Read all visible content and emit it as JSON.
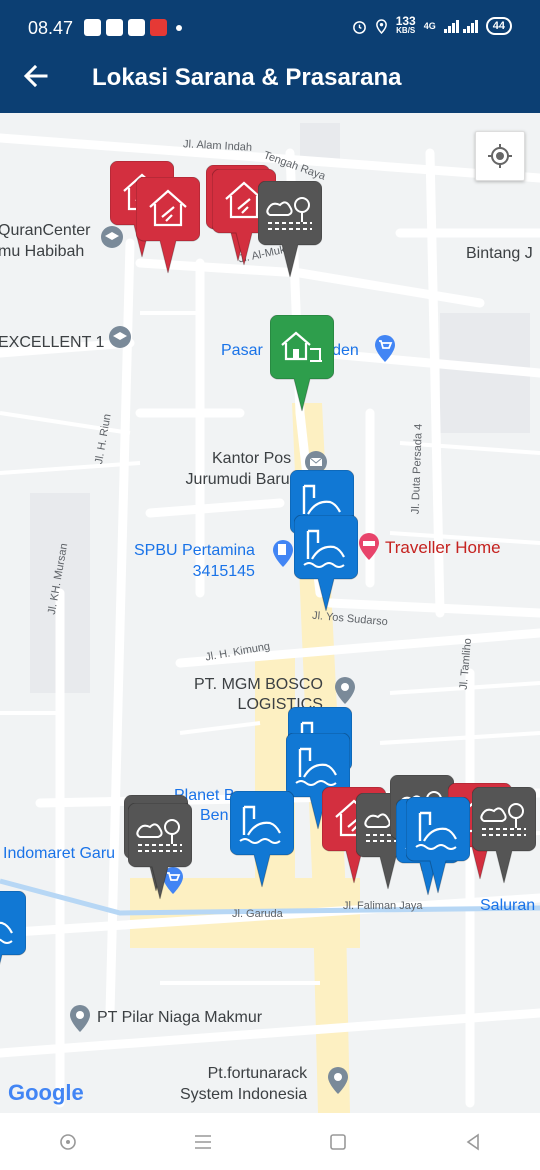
{
  "status_bar": {
    "time": "08.47",
    "speed_value": "133",
    "speed_unit": "KB/S",
    "network": "4G",
    "battery": "44"
  },
  "app_bar": {
    "title": "Lokasi Sarana & Prasarana",
    "back_icon": "arrow-left-icon"
  },
  "map": {
    "pois": [
      {
        "id": "qurancenter",
        "line1": "QuranCenter",
        "line2": "mu Habibah"
      },
      {
        "id": "excellent",
        "line1": "EXCELLENT 1"
      },
      {
        "id": "bintang",
        "line1": "Bintang J"
      },
      {
        "id": "pasar",
        "line1": "Pasar",
        "line2": "rden"
      },
      {
        "id": "kantor-pos",
        "line1": "Kantor Pos",
        "line2": "Jurumudi Baru"
      },
      {
        "id": "spbu",
        "line1": "SPBU Pertamina",
        "line2": "3415145"
      },
      {
        "id": "traveller",
        "line1": "Traveller Home"
      },
      {
        "id": "mgm",
        "line1": "PT. MGM BOSCO",
        "line2": "LOGISTICS"
      },
      {
        "id": "planet",
        "line1": "Planet B",
        "line2": "Ben"
      },
      {
        "id": "indomaret",
        "line1": "Indomaret Garu"
      },
      {
        "id": "pilar",
        "line1": "PT Pilar Niaga Makmur"
      },
      {
        "id": "fortunarack",
        "line1": "Pt.fortunarack",
        "line2": "System Indonesia"
      },
      {
        "id": "saluran",
        "line1": "Saluran I"
      }
    ],
    "roads": {
      "alam_indah": "Jl. Alam Indah",
      "tengah_raya": "Tengah Raya",
      "al_mukh": "Jl. Al-Mukh",
      "h_riun": "Jl. H. Riun",
      "kh_mursan": "Jl. KH. Mursan",
      "duta_persada": "Jl. Duta Persada 4",
      "yos_sudarso": "Jl. Yos Sudarso",
      "h_kimung": "Jl. H. Kimung",
      "tamliho": "Jl. Tamliho",
      "garuda": "Jl. Garuda",
      "faliman": "Jl. Faliman Jaya"
    },
    "google_logo": "Google",
    "marker_colors": {
      "house": "#d32f3f",
      "park": "#555555",
      "market": "#2e9e4c",
      "water": "#1178d4"
    }
  },
  "nav": {
    "icons": [
      "home-circle-icon",
      "menu-icon",
      "square-icon",
      "back-triangle-icon"
    ]
  }
}
